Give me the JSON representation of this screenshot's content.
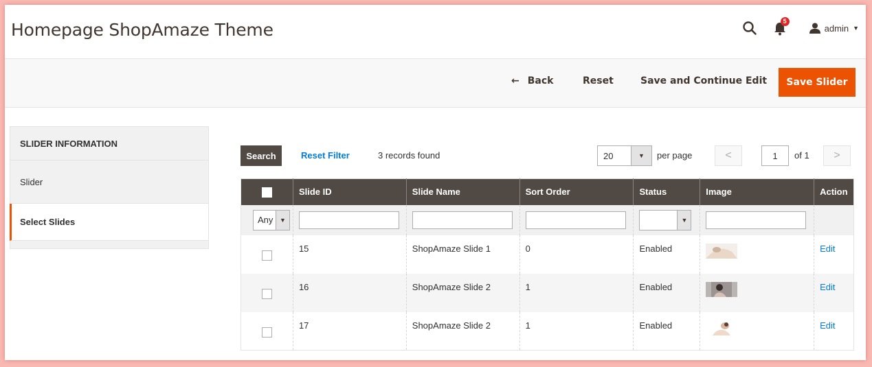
{
  "header": {
    "title": "Homepage ShopAmaze Theme",
    "notification_count": "5",
    "user_name": "admin",
    "icons": [
      "search-icon",
      "bell-icon",
      "user-icon",
      "caret-down-icon"
    ]
  },
  "actions": {
    "back": "Back",
    "reset": "Reset",
    "save_continue": "Save and Continue Edit",
    "save_slider": "Save Slider"
  },
  "sidebar": {
    "title": "SLIDER INFORMATION",
    "items": [
      {
        "label": "Slider"
      },
      {
        "label": "Select Slides"
      }
    ]
  },
  "grid_controls": {
    "search": "Search",
    "reset_filter": "Reset Filter",
    "records_found": "3 records found",
    "per_page_value": "20",
    "per_page_label": "per page",
    "current_page": "1",
    "page_of": "of 1"
  },
  "table": {
    "columns": [
      "Slide ID",
      "Slide Name",
      "Sort Order",
      "Status",
      "Image",
      "Action"
    ],
    "filter_any": "Any",
    "rows": [
      {
        "id": "15",
        "name": "ShopAmaze Slide 1",
        "sort": "0",
        "status": "Enabled",
        "action": "Edit"
      },
      {
        "id": "16",
        "name": "ShopAmaze Slide 2",
        "sort": "1",
        "status": "Enabled",
        "action": "Edit"
      },
      {
        "id": "17",
        "name": "ShopAmaze Slide 2",
        "sort": "1",
        "status": "Enabled",
        "action": "Edit"
      }
    ]
  },
  "colors": {
    "accent": "#eb5202",
    "dark": "#514943",
    "link": "#007bdb",
    "frame_border": "#f9b9b3"
  }
}
